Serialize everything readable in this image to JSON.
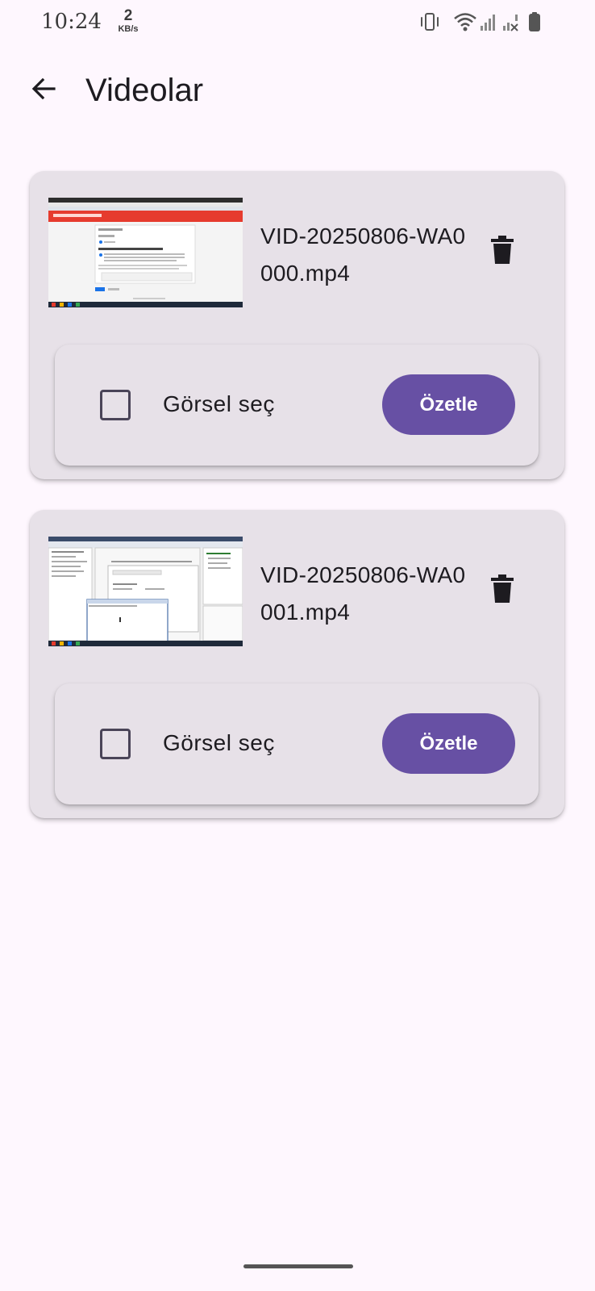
{
  "status_bar": {
    "time": "10:24",
    "net_speed_value": "2",
    "net_speed_unit": "KB/s",
    "icons": [
      "vibrate-icon",
      "wifi-icon",
      "signal-icon",
      "signal-no-service-icon",
      "battery-icon"
    ]
  },
  "app_bar": {
    "title": "Videolar",
    "back_icon": "arrow-back-icon"
  },
  "videos": [
    {
      "file_name": "VID-20250806-WA0000.mp4",
      "thumbnail": "video-thumbnail",
      "delete_icon": "trash-icon",
      "checkbox_label": "Görsel seç",
      "checked": false,
      "button_label": "Özetle"
    },
    {
      "file_name": "VID-20250806-WA0001.mp4",
      "thumbnail": "video-thumbnail",
      "delete_icon": "trash-icon",
      "checkbox_label": "Görsel seç",
      "checked": false,
      "button_label": "Özetle"
    }
  ],
  "colors": {
    "background": "#FEF7FE",
    "card": "#E7E1E8",
    "primary": "#6750A4",
    "on_surface": "#1D1B20"
  }
}
